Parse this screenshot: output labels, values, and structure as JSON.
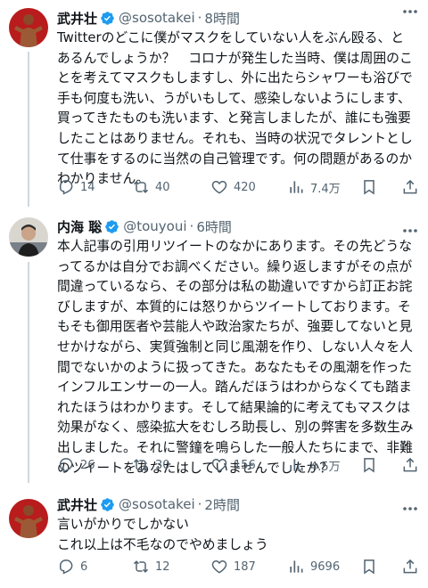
{
  "tweets": [
    {
      "display_name": "武井壮",
      "handle": "@sosotakei",
      "separator": "·",
      "time": "8時間",
      "text_lines": [
        "Twitterのどこに僕がマスクをしていない人をぶん殴る、と",
        "あるんでしょうか？　コロナが発生した当時、僕は周囲のこ",
        "とを考えてマスクもしますし、外に出たらシャワーも浴びで",
        "手も何度も洗い、うがいもして、感染しないようにします、",
        "買ってきたものも洗います、と発言しましたが、誰にも強要",
        "したことはありません。それも、当時の状況でタレントとし",
        "て仕事をするのに当然の自己管理です。何の問題があるのか",
        "わかりません。"
      ],
      "replies": "14",
      "retweets": "40",
      "likes": "420",
      "views": "7.4万"
    },
    {
      "display_name": "内海 聡",
      "handle": "@touyoui",
      "separator": "·",
      "time": "6時間",
      "text_lines": [
        "本人記事の引用リツイートのなかにあります。その先どうな",
        "ってるかは自分でお調べください。繰り返しますがその点が",
        "間違っているなら、その部分は私の勘違いですから訂正お詫",
        "びしますが、本質的には怒りからツイートしております。そ",
        "もそも御用医者や芸能人や政治家たちが、強要してないと見",
        "せかけながら、実質強制と同じ風潮を作り、しない人々を人",
        "間でないかのように扱ってきた。あなたもその風潮を作った",
        "インフルエンサーの一人。踏んだほうはわからなくても踏ま",
        "れたほうはわかります。そして結果論的に考えてもマスクは",
        "効果がなく、感染拡大をむしろ助長し、別の弊害を多数生み",
        "出しました。それに警鐘を鳴らした一般人たちにまで、非難",
        "のツイートをあなたはしていませんでしたか？"
      ],
      "replies": "26",
      "retweets": "30",
      "likes": "156",
      "views": "4.5万"
    },
    {
      "display_name": "武井壮",
      "handle": "@sosotakei",
      "separator": "·",
      "time": "2時間",
      "text_lines": [
        "言いがかりでしかない",
        "これ以上は不毛なのでやめましょう"
      ],
      "replies": "6",
      "retweets": "12",
      "likes": "187",
      "views": "9696"
    }
  ],
  "icons": {
    "reply": "reply-icon",
    "retweet": "retweet-icon",
    "like": "heart-icon",
    "views": "views-icon",
    "bookmark": "bookmark-icon",
    "share": "share-icon",
    "more": "more-icon",
    "verified": "verified-badge-icon"
  },
  "colors": {
    "verified_blue": "#1d9bf0",
    "secondary_text": "#536471",
    "thread_line": "#cfd9de"
  }
}
